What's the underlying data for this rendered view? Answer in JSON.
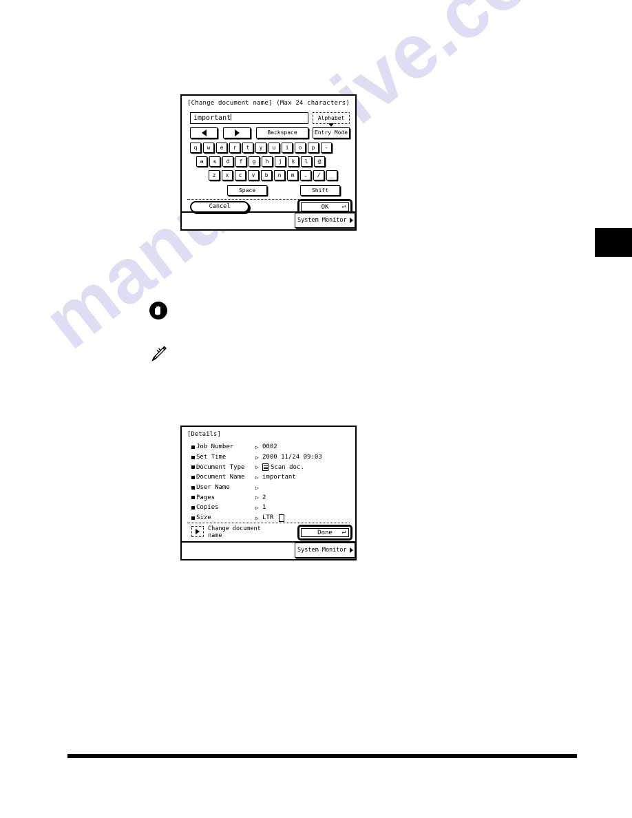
{
  "page": {
    "watermark": "manualshive.com"
  },
  "annotations": {
    "important_icon": "important-hand-icon",
    "note_icon": "note-pencil-icon",
    "chapter_tab": "chapter-thumb-tab"
  },
  "keyboard_screen": {
    "title": "[Change document name] (Max 24 characters)",
    "text_field": {
      "value": "important",
      "placeholder": ""
    },
    "mode_buttons": [
      {
        "name": "alphabet",
        "label": "Alphabet",
        "selected": true
      },
      {
        "name": "entry-mode",
        "label": "Entry Mode",
        "selected": false
      }
    ],
    "edit_buttons": [
      {
        "name": "cursor-left",
        "label": "◀"
      },
      {
        "name": "cursor-right",
        "label": "▶"
      },
      {
        "name": "backspace",
        "label": "Backspace"
      }
    ],
    "keys": {
      "row1": [
        "q",
        "w",
        "e",
        "r",
        "t",
        "y",
        "u",
        "i",
        "o",
        "p",
        "-"
      ],
      "row2": [
        "a",
        "s",
        "d",
        "f",
        "g",
        "h",
        "j",
        "k",
        "l",
        "@"
      ],
      "row3": [
        "z",
        "x",
        "c",
        "v",
        "b",
        "n",
        "m",
        ".",
        "/",
        "_"
      ]
    },
    "space_label": "Space",
    "shift_label": "Shift",
    "cancel_label": "Cancel",
    "ok_label": "OK",
    "enter_glyph": "↵",
    "status_bar": {
      "system_monitor_label": "System Monitor"
    }
  },
  "details_screen": {
    "title": "[Details]",
    "arrow_glyph": "▷",
    "rows": [
      {
        "label": "Job Number",
        "value": "0002",
        "icon": ""
      },
      {
        "label": "Set Time",
        "value": "2000 11/24 09:03",
        "icon": ""
      },
      {
        "label": "Document Type",
        "value": "Scan doc.",
        "icon": "scan-document-icon"
      },
      {
        "label": "Document Name",
        "value": "important",
        "icon": ""
      },
      {
        "label": "User Name",
        "value": "",
        "icon": ""
      },
      {
        "label": "Pages",
        "value": "2",
        "icon": ""
      },
      {
        "label": "Copies",
        "value": "1",
        "icon": ""
      },
      {
        "label": "Size",
        "value": "LTR",
        "icon": "paper-portrait-icon"
      }
    ],
    "change_name_label": "Change document name",
    "done_label": "Done",
    "enter_glyph": "↵",
    "status_bar": {
      "system_monitor_label": "System Monitor"
    }
  }
}
